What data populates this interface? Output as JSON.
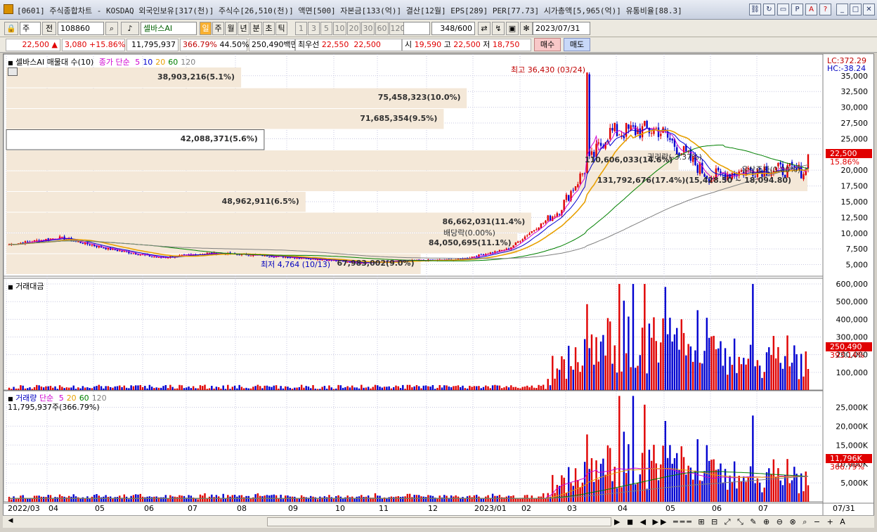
{
  "window": {
    "title": "[0601] 주식종합차트 - KOSDAQ 외국인보유[317(천)] 주식수[26,510(천)] 액면[500] 자본금[133(억)] 결산[12월] EPS[289] PER[77.73] 시가총액[5,965(억)] 유통비율[88.3]",
    "buttons": [
      "link-icon",
      "refresh-icon",
      "window-icon",
      "ppt-icon",
      "font-icon",
      "help-icon",
      "minimize-icon",
      "maximize-icon",
      "close-icon"
    ]
  },
  "toolbar": {
    "type_select": "주",
    "prev_label": "전",
    "code": "108860",
    "stock_name": "셀바스AI",
    "period_buttons": [
      "일",
      "주",
      "월",
      "년",
      "분",
      "초",
      "틱"
    ],
    "active_period": "일",
    "interval_buttons": [
      "1",
      "3",
      "5",
      "10",
      "20",
      "30",
      "60",
      "120"
    ],
    "count": "348",
    "count_total": "/600",
    "date": "2023/07/31"
  },
  "quote": {
    "price": "22,500",
    "direction": "▲",
    "change": "3,080",
    "change_pct": "+15.86%",
    "volume": "11,795,937",
    "volume_ratio": "366.79%",
    "turnover": "44.50%",
    "amount": "250,490백만",
    "best_label": "최우선",
    "best_ask": "22,550",
    "best_bid": "22,500",
    "open_label": "시",
    "open": "19,590",
    "high_label": "고",
    "high": "22,500",
    "low_label": "저",
    "low": "18,750",
    "buy_button": "매수",
    "sell_button": "매도"
  },
  "price_pane": {
    "legend_name": "셀바스AI 매물대 수(10)",
    "ma_label": "종가 단순",
    "ma_periods": [
      "5",
      "10",
      "20",
      "60",
      "120"
    ],
    "ma_colors": [
      "#d000d0",
      "#0000d0",
      "#e8a000",
      "#008000",
      "#808080"
    ],
    "lc": "LC:372.29",
    "hc": "HC:-38.24",
    "current_price": "22,500",
    "current_pct": "15.86%",
    "y_ticks": [
      "35,000",
      "32,500",
      "30,000",
      "27,500",
      "25,000",
      "22,500",
      "20,000",
      "17,500",
      "15,000",
      "12,500",
      "10,000",
      "7,500",
      "5,000"
    ],
    "high_note": "최고 36,430 (03/24)",
    "low_note": "최저 4,764 (10/13)",
    "events": [
      "권리락(-3.37%)",
      "유상증자(0.00%)",
      "배당락(0.00%)"
    ],
    "volume_profile": [
      {
        "label": "38,903,216(5.1%)",
        "frac": 0.051
      },
      {
        "label": "75,458,323(10.0%)",
        "frac": 0.1
      },
      {
        "label": "71,685,354(9.5%)",
        "frac": 0.095
      },
      {
        "label": "42,088,371(5.6%)",
        "frac": 0.056
      },
      {
        "label": "110,606,033(14.6%)",
        "frac": 0.146
      },
      {
        "label": "131,792,676(17.4%)(15,428.50 ~ 18,094.80)",
        "frac": 0.174
      },
      {
        "label": "48,962,911(6.5%)",
        "frac": 0.065
      },
      {
        "label": "86,662,031(11.4%)",
        "frac": 0.114
      },
      {
        "label": "84,050,695(11.1%)",
        "frac": 0.111
      },
      {
        "label": "67,983,002(9.0%)",
        "frac": 0.09
      }
    ]
  },
  "amount_pane": {
    "title": "거래대금",
    "y_ticks": [
      "600,000",
      "500,000",
      "400,000",
      "300,000",
      "200,000",
      "100,000"
    ],
    "current": "250,490",
    "current_pct": "393.14%"
  },
  "volume_pane": {
    "title": "거래량",
    "ma_label": "단순",
    "ma_periods": [
      "5",
      "20",
      "60",
      "120"
    ],
    "info": "11,795,937주(366.79%)",
    "y_ticks": [
      "25,000K",
      "20,000K",
      "15,000K",
      "10,000K",
      "5,000K"
    ],
    "current": "11,796K",
    "current_pct": "366.79%"
  },
  "x_axis": {
    "labels": [
      "2022/03",
      "04",
      "05",
      "06",
      "07",
      "08",
      "09",
      "10",
      "11",
      "12",
      "2023/01",
      "02",
      "03",
      "04",
      "05",
      "06",
      "07"
    ],
    "end_label": "07/31"
  },
  "chart_data": {
    "type": "candlestick",
    "price_range": [
      3500,
      36430
    ],
    "high": 36430,
    "low": 4764,
    "close_last": 22500,
    "monthly_close": [
      8200,
      9300,
      7500,
      6100,
      6800,
      6500,
      6000,
      5300,
      5600,
      5800,
      7500,
      13500,
      26000,
      26500,
      19000,
      20200,
      19800
    ]
  }
}
